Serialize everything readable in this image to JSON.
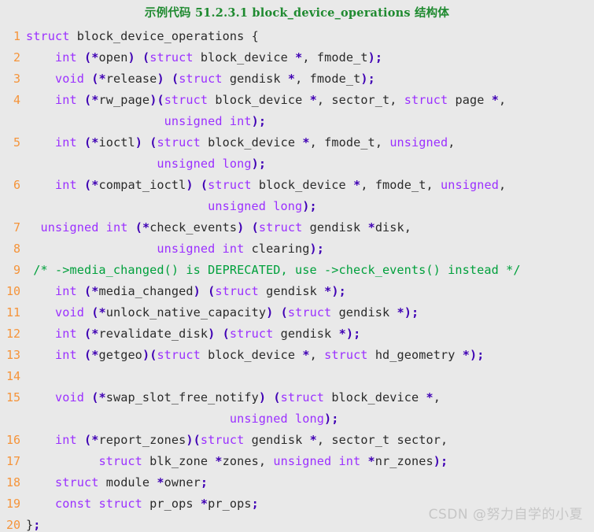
{
  "title": "示例代码 51.2.3.1 block_device_operations 结构体",
  "watermark": "CSDN @努力自学的小夏",
  "colors": {
    "background": "#e9e9e9",
    "title_green": "#1f8a30",
    "line_number_orange": "#f5943a",
    "keyword_purple": "#9b30ff",
    "punctuation_blue": "#3f00b4",
    "identifier_gray": "#2b2b2b",
    "comment_green": "#00a03c",
    "watermark_gray": "#c6c6c6"
  },
  "code": {
    "language": "c",
    "line_count": 20,
    "lines": [
      {
        "number": "1",
        "text": "struct block_device_operations {"
      },
      {
        "number": "2",
        "text": "    int (*open) (struct block_device *, fmode_t);"
      },
      {
        "number": "3",
        "text": "    void (*release) (struct gendisk *, fmode_t);"
      },
      {
        "number": "4",
        "text": "    int (*rw_page)(struct block_device *, sector_t, struct page *,"
      },
      {
        "number": "",
        "text": "                   unsigned int);"
      },
      {
        "number": "5",
        "text": "    int (*ioctl) (struct block_device *, fmode_t, unsigned,"
      },
      {
        "number": "",
        "text": "                  unsigned long);"
      },
      {
        "number": "6",
        "text": "    int (*compat_ioctl) (struct block_device *, fmode_t, unsigned,"
      },
      {
        "number": "",
        "text": "                         unsigned long);"
      },
      {
        "number": "7",
        "text": "  unsigned int (*check_events) (struct gendisk *disk,"
      },
      {
        "number": "8",
        "text": "                  unsigned int clearing);"
      },
      {
        "number": "9",
        "text": " /* ->media_changed() is DEPRECATED, use ->check_events() instead */"
      },
      {
        "number": "10",
        "text": "    int (*media_changed) (struct gendisk *);"
      },
      {
        "number": "11",
        "text": "    void (*unlock_native_capacity) (struct gendisk *);"
      },
      {
        "number": "12",
        "text": "    int (*revalidate_disk) (struct gendisk *);"
      },
      {
        "number": "13",
        "text": "    int (*getgeo)(struct block_device *, struct hd_geometry *);"
      },
      {
        "number": "14",
        "text": ""
      },
      {
        "number": "15",
        "text": "    void (*swap_slot_free_notify) (struct block_device *,"
      },
      {
        "number": "",
        "text": "                            unsigned long);"
      },
      {
        "number": "16",
        "text": "    int (*report_zones)(struct gendisk *, sector_t sector,"
      },
      {
        "number": "17",
        "text": "          struct blk_zone *zones, unsigned int *nr_zones);"
      },
      {
        "number": "18",
        "text": "    struct module *owner;"
      },
      {
        "number": "19",
        "text": "    const struct pr_ops *pr_ops;"
      },
      {
        "number": "20",
        "text": "};"
      }
    ],
    "tokens": {
      "keywords": [
        "struct",
        "int",
        "void",
        "unsigned",
        "long",
        "const"
      ],
      "types": [
        "fmode_t",
        "sector_t",
        "gendisk",
        "block_device",
        "page",
        "hd_geometry",
        "blk_zone",
        "module",
        "pr_ops"
      ],
      "comment_text": "/* ->media_changed() is DEPRECATED, use ->check_events() instead */"
    }
  }
}
